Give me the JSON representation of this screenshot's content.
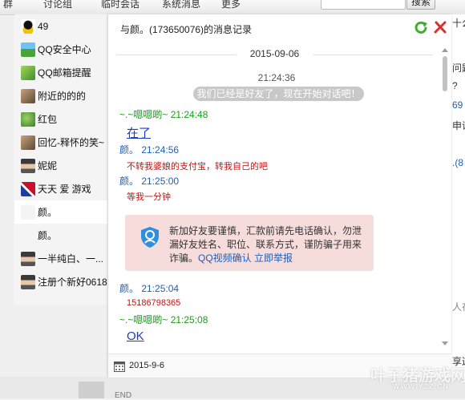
{
  "background_window": {
    "tabs": [
      "群",
      "讨论组",
      "临时会话",
      "系统消息",
      "更多"
    ],
    "search_button": "搜索",
    "right_fragments": [
      "十么",
      "问题",
      "?",
      "69",
      "申请",
      ".(8",
      "人在",
      "享这"
    ],
    "end_label": "END"
  },
  "watermark": {
    "text": "叶子猪游戏网",
    "sub": "WWW.YZZ.CN"
  },
  "contacts": [
    {
      "label": "49",
      "avatar": "qq-penguin"
    },
    {
      "label": "QQ安全中心",
      "avatar": "landscape"
    },
    {
      "label": "QQ邮箱提醒",
      "avatar": "grass"
    },
    {
      "label": "附近的的的",
      "avatar": "photo"
    },
    {
      "label": "红包",
      "avatar": "leaf"
    },
    {
      "label": "回忆-释怀的笑~",
      "avatar": "photo"
    },
    {
      "label": "妮妮",
      "avatar": "portrait"
    },
    {
      "label": "天天 爱 游戏",
      "avatar": "flag"
    },
    {
      "label": "颜。",
      "avatar": "blank",
      "selected": true
    },
    {
      "label": "颜。",
      "avatar": "blank"
    },
    {
      "label": "一半纯白、一...",
      "avatar": "portrait"
    },
    {
      "label": "注册个新好0618",
      "avatar": "portrait"
    }
  ],
  "chat": {
    "title": "与颜。(173650076)的消息记录",
    "date_separator": "2015-09-06",
    "system_time": "21:24:36",
    "system_notice": "我们已经是好友了，现在开始对话吧！",
    "messages": [
      {
        "head": "~.~嗯嗯啲~ 21:24:48",
        "body": "在了",
        "head_style": "green",
        "body_style": "big"
      },
      {
        "head": "颜。 21:24:56",
        "body": "不转我婆娘的支付宝，转我自己的吧",
        "head_style": "blue",
        "body_style": "red"
      },
      {
        "head": "颜。 21:25:00",
        "body": "等我一分钟",
        "head_style": "blue",
        "body_style": "red"
      },
      {
        "head": "颜。 21:25:04",
        "body": "15186798365",
        "head_style": "blue",
        "body_style": "red"
      },
      {
        "head": "~.~嗯嗯啲~ 21:25:08",
        "body": "OK",
        "head_style": "green",
        "body_style": "big"
      }
    ],
    "warning": {
      "text": "新加好友要谨慎，汇款前请先电话确认，勿泄漏好友姓名、职位、联系方式，谨防骗子用来诈骗。",
      "link_video": "QQ视频确认",
      "link_report": "立即举报"
    },
    "footer_date": "2015-9-6"
  },
  "colors": {
    "green_sender": "#1a9e1a",
    "blue_sender": "#1e5fb4",
    "red_text": "#cc1111",
    "warning_bg": "#f7dcdc"
  }
}
